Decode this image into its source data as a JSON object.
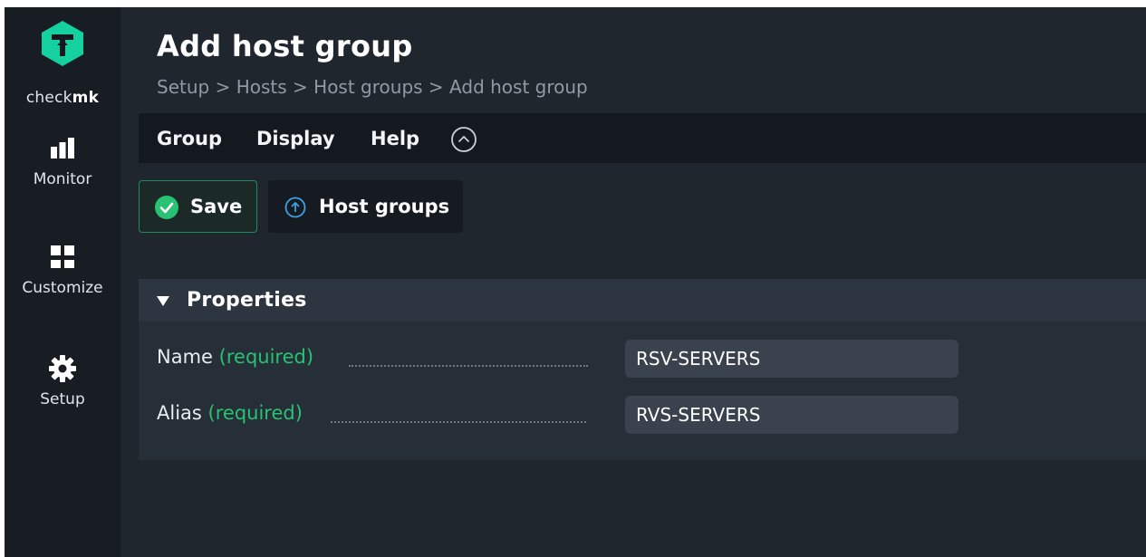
{
  "sidebar": {
    "logo_text_light": "check",
    "logo_text_bold": "mk",
    "items": [
      {
        "label": "Monitor",
        "icon": "bar-chart-icon"
      },
      {
        "label": "Customize",
        "icon": "grid-icon"
      },
      {
        "label": "Setup",
        "icon": "gear-icon"
      }
    ]
  },
  "header": {
    "title": "Add host group",
    "breadcrumb": [
      "Setup",
      "Hosts",
      "Host groups",
      "Add host group"
    ],
    "separator": " > "
  },
  "menu": {
    "items": [
      "Group",
      "Display",
      "Help"
    ]
  },
  "toolbar": {
    "save_label": "Save",
    "hostgroups_label": "Host groups"
  },
  "properties": {
    "title": "Properties",
    "fields": [
      {
        "label": "Name",
        "required": "(required)",
        "value": "RSV-SERVERS"
      },
      {
        "label": "Alias",
        "required": "(required)",
        "value": "RVS-SERVERS"
      }
    ]
  },
  "colors": {
    "accent_green": "#29c274",
    "accent_blue": "#3aa1e6",
    "background": "#1f262e",
    "sidebar": "#181d23"
  }
}
